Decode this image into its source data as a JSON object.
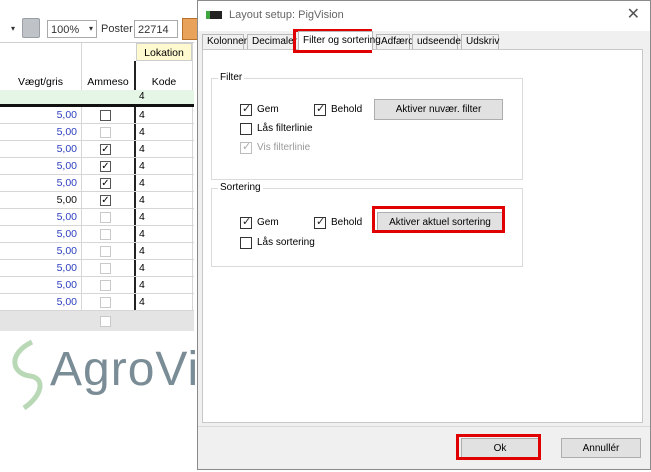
{
  "toolbar": {
    "zoom": "100%",
    "poster_label": "Poster",
    "poster_value": "22714"
  },
  "grid": {
    "header_group": "Lokation",
    "columns": [
      "Vægt/gris",
      "Ammeso",
      "Kode"
    ],
    "top_code": "4",
    "rows": [
      {
        "value": "5,00",
        "checked": false,
        "enabled": true,
        "code": "4"
      },
      {
        "value": "5,00",
        "checked": false,
        "enabled": false,
        "code": "4"
      },
      {
        "value": "5,00",
        "checked": true,
        "enabled": true,
        "code": "4"
      },
      {
        "value": "5,00",
        "checked": true,
        "enabled": true,
        "code": "4"
      },
      {
        "value": "5,00",
        "checked": true,
        "enabled": true,
        "code": "4"
      },
      {
        "value": "5,00",
        "checked": true,
        "enabled": true,
        "code": "4"
      },
      {
        "value": "5,00",
        "checked": false,
        "enabled": false,
        "code": "4"
      },
      {
        "value": "5,00",
        "checked": false,
        "enabled": false,
        "code": "4"
      },
      {
        "value": "5,00",
        "checked": false,
        "enabled": false,
        "code": "4"
      },
      {
        "value": "5,00",
        "checked": false,
        "enabled": false,
        "code": "4"
      },
      {
        "value": "5,00",
        "checked": false,
        "enabled": false,
        "code": "4"
      },
      {
        "value": "5,00",
        "checked": false,
        "enabled": false,
        "code": "4"
      }
    ],
    "value_colors": [
      "#2d3fbf",
      "#2d3fbf",
      "#2d3fbf",
      "#2d3fbf",
      "#2d3fbf",
      "#111111",
      "#2d3fbf",
      "#2d3fbf",
      "#2d3fbf",
      "#2d3fbf",
      "#2d3fbf",
      "#2d3fbf"
    ]
  },
  "logo": {
    "text": "AgroVis"
  },
  "dialog": {
    "title": "Layout setup: PigVision",
    "tabs": [
      {
        "label": "Kolonner",
        "active": false
      },
      {
        "label": "Decimaler",
        "active": false
      },
      {
        "label": "Filter og sortering",
        "active": true
      },
      {
        "label": "Adfærd",
        "active": false
      },
      {
        "label": "udseende",
        "active": false
      },
      {
        "label": "Udskriv",
        "active": false
      }
    ],
    "filter": {
      "title": "Filter",
      "gem": {
        "label": "Gem",
        "checked": true
      },
      "behold": {
        "label": "Behold",
        "checked": true
      },
      "laas": {
        "label": "Lås filterlinie",
        "checked": false
      },
      "vis": {
        "label": "Vis filterlinie",
        "checked": true,
        "disabled": true
      },
      "button": "Aktiver nuvær. filter"
    },
    "sortering": {
      "title": "Sortering",
      "gem": {
        "label": "Gem",
        "checked": true
      },
      "behold": {
        "label": "Behold",
        "checked": true
      },
      "laas": {
        "label": "Lås sortering",
        "checked": false
      },
      "button": "Aktiver aktuel sortering"
    },
    "ok_label": "Ok",
    "cancel_label": "Annullér"
  },
  "colors": {
    "highlight": "#e00000",
    "grid_header": "#fff9cf",
    "value_blue": "#2d3fbf"
  }
}
